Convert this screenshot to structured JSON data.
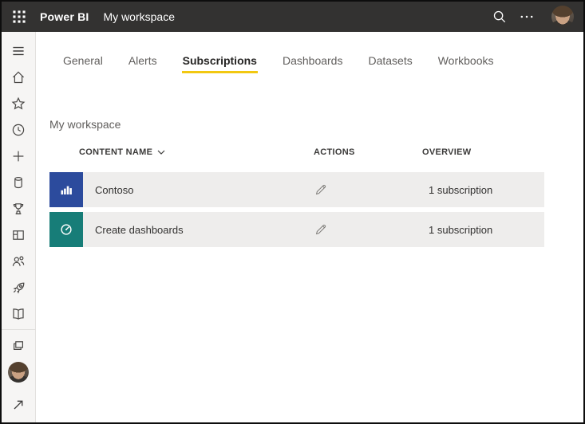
{
  "topbar": {
    "app_name": "Power BI",
    "workspace_label": "My workspace",
    "icons": [
      "app-launcher",
      "search",
      "more-options",
      "account-avatar"
    ]
  },
  "sidebar": {
    "icons": [
      "menu",
      "home",
      "favorites",
      "recent",
      "create",
      "datasets",
      "goals",
      "apps",
      "shared-with-me",
      "deployment-pipelines",
      "learn",
      "workspaces",
      "my-workspace-avatar",
      "navigation-expand"
    ]
  },
  "tabs": [
    {
      "label": "General",
      "active": false
    },
    {
      "label": "Alerts",
      "active": false
    },
    {
      "label": "Subscriptions",
      "active": true
    },
    {
      "label": "Dashboards",
      "active": false
    },
    {
      "label": "Datasets",
      "active": false
    },
    {
      "label": "Workbooks",
      "active": false
    }
  ],
  "main": {
    "heading": "My workspace",
    "table": {
      "headers": {
        "name": "CONTENT NAME",
        "actions": "ACTIONS",
        "overview": "OVERVIEW"
      },
      "rows": [
        {
          "name": "Contoso",
          "icon": "bar-chart-icon",
          "tile_color": "#2c4b9d",
          "action": "edit",
          "overview": "1 subscription"
        },
        {
          "name": "Create dashboards",
          "icon": "gauge-icon",
          "tile_color": "#177d78",
          "action": "edit",
          "overview": "1 subscription"
        }
      ]
    }
  },
  "colors": {
    "topbar_bg": "#333231",
    "sidebar_bg": "#f6f5f4",
    "active_tab_underline": "#f2c811",
    "row_bg": "#eeedec",
    "tile_blue": "#2c4b9d",
    "tile_teal": "#177d78"
  }
}
